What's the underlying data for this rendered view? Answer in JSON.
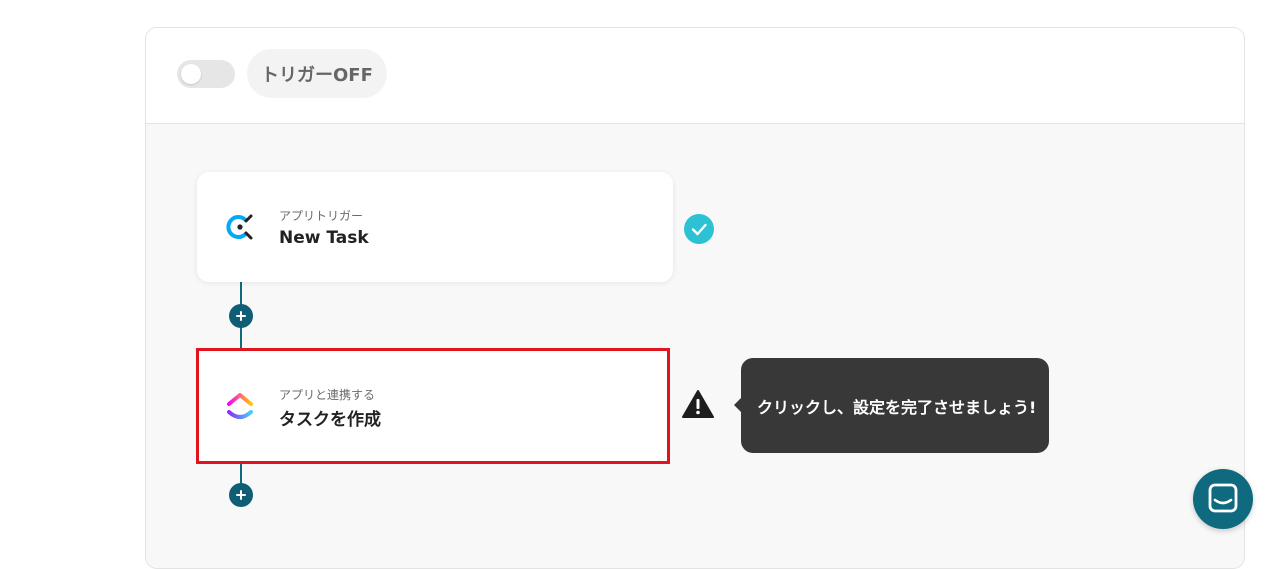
{
  "header": {
    "trigger_toggle": {
      "state": "off"
    },
    "trigger_status_label": "トリガーOFF"
  },
  "flow": {
    "steps": [
      {
        "subtitle": "アプリトリガー",
        "title": "New Task",
        "app_icon": "clockify-icon",
        "status": "complete",
        "status_icon": "check-icon"
      },
      {
        "subtitle": "アプリと連携する",
        "title": "タスクを作成",
        "app_icon": "clickup-icon",
        "status": "incomplete",
        "status_icon": "warning-icon",
        "highlighted": true
      }
    ],
    "tooltip": "クリックし、設定を完了させましょう!"
  },
  "chat": {
    "icon": "chat-icon"
  },
  "colors": {
    "connector": "#0f6a80",
    "check": "#2cc2d3",
    "highlight_border": "#e0141d",
    "tooltip_bg": "#383838",
    "chat_button": "#0f6a80",
    "clockify_blue": "#03a9f4",
    "clickup_pink": "#fa12e3",
    "clickup_purple": "#7b68ee"
  }
}
